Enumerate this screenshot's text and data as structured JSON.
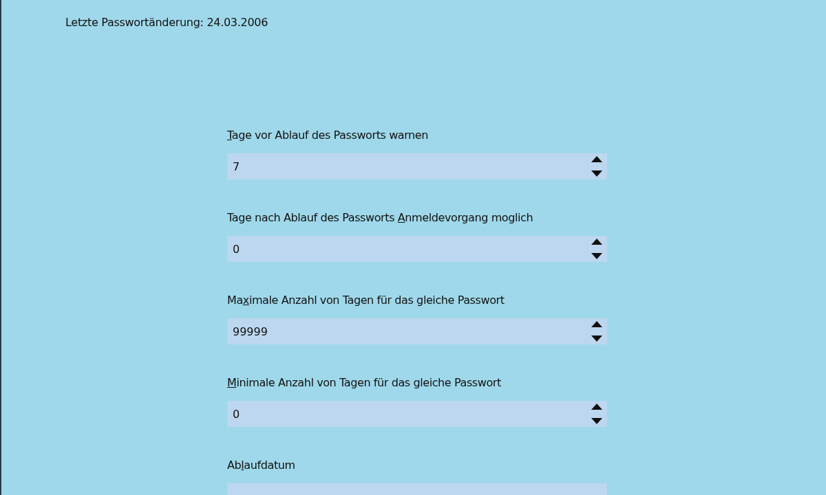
{
  "last_change": "Letzte Passwortänderung: 24.03.2006",
  "fields": [
    {
      "kind": "spin",
      "label": {
        "key": "T",
        "after": "age vor Ablauf des Passworts warnen"
      },
      "value": "7"
    },
    {
      "kind": "spin",
      "label": {
        "before": "Tage nach Ablauf des Passworts ",
        "key": "A",
        "after": "nmeldevorgang moglich"
      },
      "value": "0"
    },
    {
      "kind": "spin",
      "label": {
        "before": "Ma",
        "key": "x",
        "after": "imale Anzahl von Tagen für das gleiche Passwort"
      },
      "value": "99999"
    },
    {
      "kind": "spin",
      "label": {
        "key": "M",
        "after": "inimale Anzahl von Tagen für das gleiche Passwort"
      },
      "value": "0"
    },
    {
      "kind": "text",
      "label": {
        "before": "Ab",
        "key": "l",
        "after": "aufdatum"
      }
    }
  ]
}
